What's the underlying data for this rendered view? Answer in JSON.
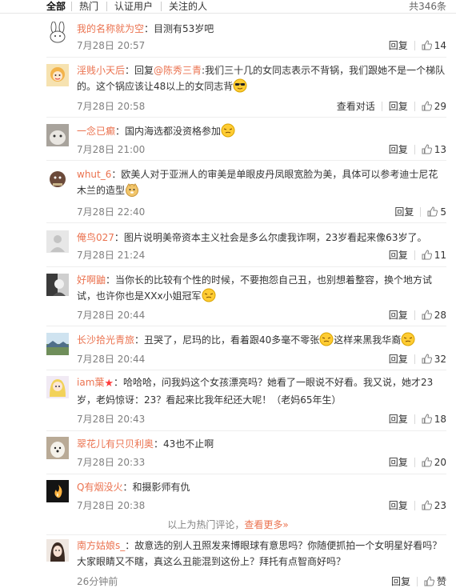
{
  "tabs": {
    "all": "全部",
    "hot": "热门",
    "verified": "认证用户",
    "following": "关注的人"
  },
  "total": "共346条",
  "actions": {
    "reply": "回复",
    "view_conversation": "查看对话"
  },
  "comments": [
    {
      "user": "我的名称就为空",
      "text": "：目测有53岁吧",
      "time": "7月28日 20:57",
      "likes": "14"
    },
    {
      "user": "淫贱小天后",
      "prefix": "：回复",
      "at": "@陈秀三青",
      "text": ":我们三十几的女同志表示不背锅，我们跟她不是一个梯队的。这个锅应该让48以上的女同志背",
      "time": "7月28日 20:58",
      "likes": "29"
    },
    {
      "user": "一念已癫",
      "text": "：国内海选都没资格参加",
      "time": "7月28日 21:00",
      "likes": "13"
    },
    {
      "user": "whut_6",
      "text": "：欧美人对于亚洲人的审美是单眼皮丹凤眼宽脸为美，具体可以参考迪士尼花木兰的造型",
      "time": "7月28日 22:40",
      "likes": "5"
    },
    {
      "user": "俺鸟027",
      "text": "：图片说明美帝资本主义社会是多么尔虞我诈啊，23岁看起来像63岁了。",
      "time": "7月28日 21:24",
      "likes": "11"
    },
    {
      "user": "好啊鼬",
      "text": "：当你长的比较有个性的时候，不要抱怨自己丑，也别想着整容，换个地方试试，也许你也是XXx小姐冠军",
      "time": "7月28日 20:44",
      "likes": "28"
    },
    {
      "user": "长沙拾光青旅",
      "text": "：丑哭了，尼玛的比，看着跟40多毫不零张",
      "text2": "这样来黑我华裔",
      "time": "7月28日 20:44",
      "likes": "32"
    },
    {
      "user": "iam葉",
      "text": "：哈哈哈，问我妈这个女孩漂亮吗？她看了一眼说不好看。我又说，她才23岁，老妈惊讶：23？看起来比我年纪还大呢！（老妈65年生）",
      "time": "7月28日 20:43",
      "likes": "18"
    },
    {
      "user": "翠花儿有只贝利奥",
      "text": "：43也不止啊",
      "time": "7月28日 20:33",
      "likes": "20"
    },
    {
      "user": "Q有烟没火",
      "text": "：和摄影师有仇",
      "time": "7月28日 20:38",
      "likes": "23"
    },
    {
      "user": "南方姑娘s_",
      "text": "：故意选的别人丑照发来博眼球有意思吗？你随便抓拍一个女明星好看吗？大家眼睛又不瞎，真这么丑能混到这份上？拜托有点智商好吗？",
      "time": "26分钟前",
      "likes": "赞"
    }
  ],
  "hot_note": {
    "text": "以上为热门评论，",
    "more": "查看更多»"
  }
}
